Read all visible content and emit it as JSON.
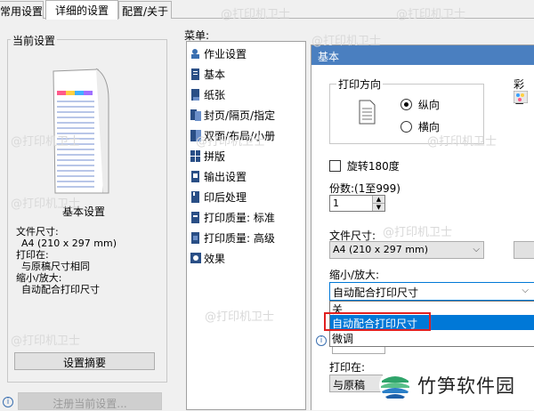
{
  "tabs": [
    "常用设置",
    "详细的设置",
    "配置/关于"
  ],
  "current_settings": {
    "legend": "当前设置",
    "caption": "基本设置",
    "paper_size_label": "文件尺寸:",
    "paper_size_value": "A4 (210 x 297 mm)",
    "print_on_label": "打印在:",
    "print_on_value": "与原稿尺寸相同",
    "zoom_label": "缩小/放大:",
    "zoom_value": "自动配合打印尺寸",
    "summary_button": "设置摘要",
    "register_button": "注册当前设置..."
  },
  "menu": {
    "label": "菜单:",
    "items": [
      {
        "label": "作业设置",
        "icon": "job-settings-icon"
      },
      {
        "label": "基本",
        "icon": "basic-icon"
      },
      {
        "label": "纸张",
        "icon": "paper-icon"
      },
      {
        "label": "封页/隔页/指定",
        "icon": "cover-icon"
      },
      {
        "label": "双面/布局/小册",
        "icon": "duplex-icon"
      },
      {
        "label": "拼版",
        "icon": "imposition-icon"
      },
      {
        "label": "输出设置",
        "icon": "output-icon"
      },
      {
        "label": "印后处理",
        "icon": "finishing-icon"
      },
      {
        "label": "打印质量: 标准",
        "icon": "quality-standard-icon"
      },
      {
        "label": "打印质量: 高级",
        "icon": "quality-advanced-icon"
      },
      {
        "label": "效果",
        "icon": "effects-icon"
      }
    ]
  },
  "basic_panel": {
    "header": "基本",
    "orientation_legend": "打印方向",
    "portrait": "纵向",
    "landscape": "横向",
    "color_label": "彩色",
    "rotate_label": "旋转180度",
    "copies_label": "份数:(1至999)",
    "copies_value": "1",
    "paper_size_label": "文件尺寸:",
    "paper_size_value": "A4 (210 x 297 mm)",
    "zoom_label": "缩小/放大:",
    "zoom_selected": "自动配合打印尺寸",
    "zoom_options": [
      "关",
      "自动配合打印尺寸",
      "微调"
    ],
    "print_on_label": "打印在:",
    "print_on_value": "与原稿"
  },
  "watermark": {
    "text": "@打印机卫士",
    "logo_text": "竹笋软件园"
  },
  "colors": {
    "panel_header": "#4a7fc0",
    "highlight": "#0078d7",
    "annotation_red": "#e02020"
  }
}
